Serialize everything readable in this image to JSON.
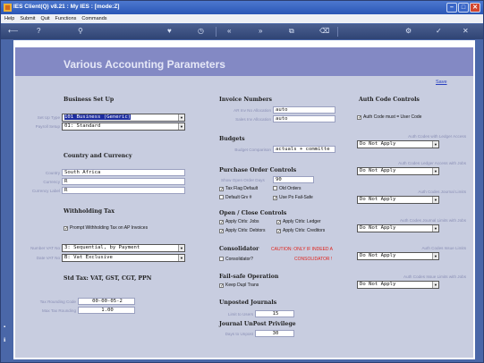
{
  "window": {
    "title": "IES Client(Q) v8.21 : My IES :     [mode:Z]"
  },
  "menu": [
    "Help",
    "Submit",
    "Quit",
    "Functions",
    "Commands"
  ],
  "page": {
    "title": "Various Accounting Parameters",
    "save_link": "Save"
  },
  "business_setup": {
    "heading": "Business Set Up",
    "set_up_type_label": "Set Up Type",
    "set_up_type": "101 Business (Generic)",
    "payroll_setup_label": "Payroll Setup",
    "payroll_setup": "01: Standard"
  },
  "country": {
    "heading": "Country and Currency",
    "country_label": "Country",
    "country": "South Africa",
    "currency_label": "Currency",
    "currency": "R",
    "currency_label_label": "Currency Label",
    "currency_label_value": "R"
  },
  "withholding": {
    "heading": "Withholding Tax",
    "prompt_label": "Prompt Withholding Tax on AP Invoices",
    "prompt_checked": true
  },
  "vat": {
    "number_label": "Number VAT No",
    "number": "3: Sequential, by Payment",
    "date_label": "Date VAT No",
    "date": "B: Vat Exclusive"
  },
  "std_tax": {
    "heading": "Std Tax: VAT, GST, CGT, PPN",
    "rounding_code_label": "Tax Rounding Code",
    "rounding_code": "00-00-05-2",
    "max_rounding_label": "Max Tax Rounding",
    "max_rounding": "1.00"
  },
  "invoice_numbers": {
    "heading": "Invoice Numbers",
    "ar_label": "AR Inv No Allocation",
    "ar": "auto",
    "sales_label": "Sales Inv Allocation",
    "sales": "auto"
  },
  "budgets": {
    "heading": "Budgets",
    "comparison_label": "Budget Comparison",
    "comparison": "actuals + committe"
  },
  "po_controls": {
    "heading": "Purchase Order Controls",
    "open_days_label": "Show Open Order Days",
    "open_days": "90",
    "tax_flag": "Tax Flag Default",
    "tax_flag_checked": true,
    "old_orders": "Old Orders",
    "old_orders_checked": false,
    "default_grv": "Default Grv #",
    "default_grv_checked": false,
    "use_po_failsafe": "Use Po Fail-Safe",
    "use_po_failsafe_checked": true
  },
  "open_close": {
    "heading": "Open / Close Controls",
    "jobs": "Apply Ctrls: Jobs",
    "ledger": "Apply Ctrls: Ledger",
    "debtors": "Apply Ctrls: Debtors",
    "creditors": "Apply Ctrls: Creditors"
  },
  "consolidator": {
    "heading": "Consolidator",
    "checkbox": "Consolidator?",
    "caution": "CAUTION: ONLY IF INDEED A",
    "caution2": "CONSOLIDATOR !"
  },
  "failsafe": {
    "heading": "Fail-safe Operation",
    "keep": "Keep Dupl Trans"
  },
  "unposted": {
    "heading": "Unposted Journals",
    "limit_label": "Limit to Users",
    "limit": "15"
  },
  "journal_unpost": {
    "heading": "Journal UnPost Privilege",
    "days_label": "Days to Unpost",
    "days": "30"
  },
  "auth": {
    "heading": "Auth Code Controls",
    "must_label": "Auth Code must = User Code",
    "ledger_access_label": "Auth Codes with Ledger Access",
    "ledger_access": "Do Not Apply",
    "ledger_jobs_label": "Auth Codes Ledger Access with Jobs",
    "ledger_jobs": "Do Not Apply",
    "journal_limits_label": "Auth Codes Journal Limits",
    "journal_limits": "Do Not Apply",
    "journal_jobs_label": "Auth Codes Journal Limits with Jobs",
    "journal_jobs": "Do Not Apply",
    "issue_limits_label": "Auth Codes Issue Limits",
    "issue_limits": "Do Not Apply",
    "issue_jobs_label": "Auth Codes Issue Limits with Jobs",
    "issue_jobs": "Do Not Apply"
  }
}
